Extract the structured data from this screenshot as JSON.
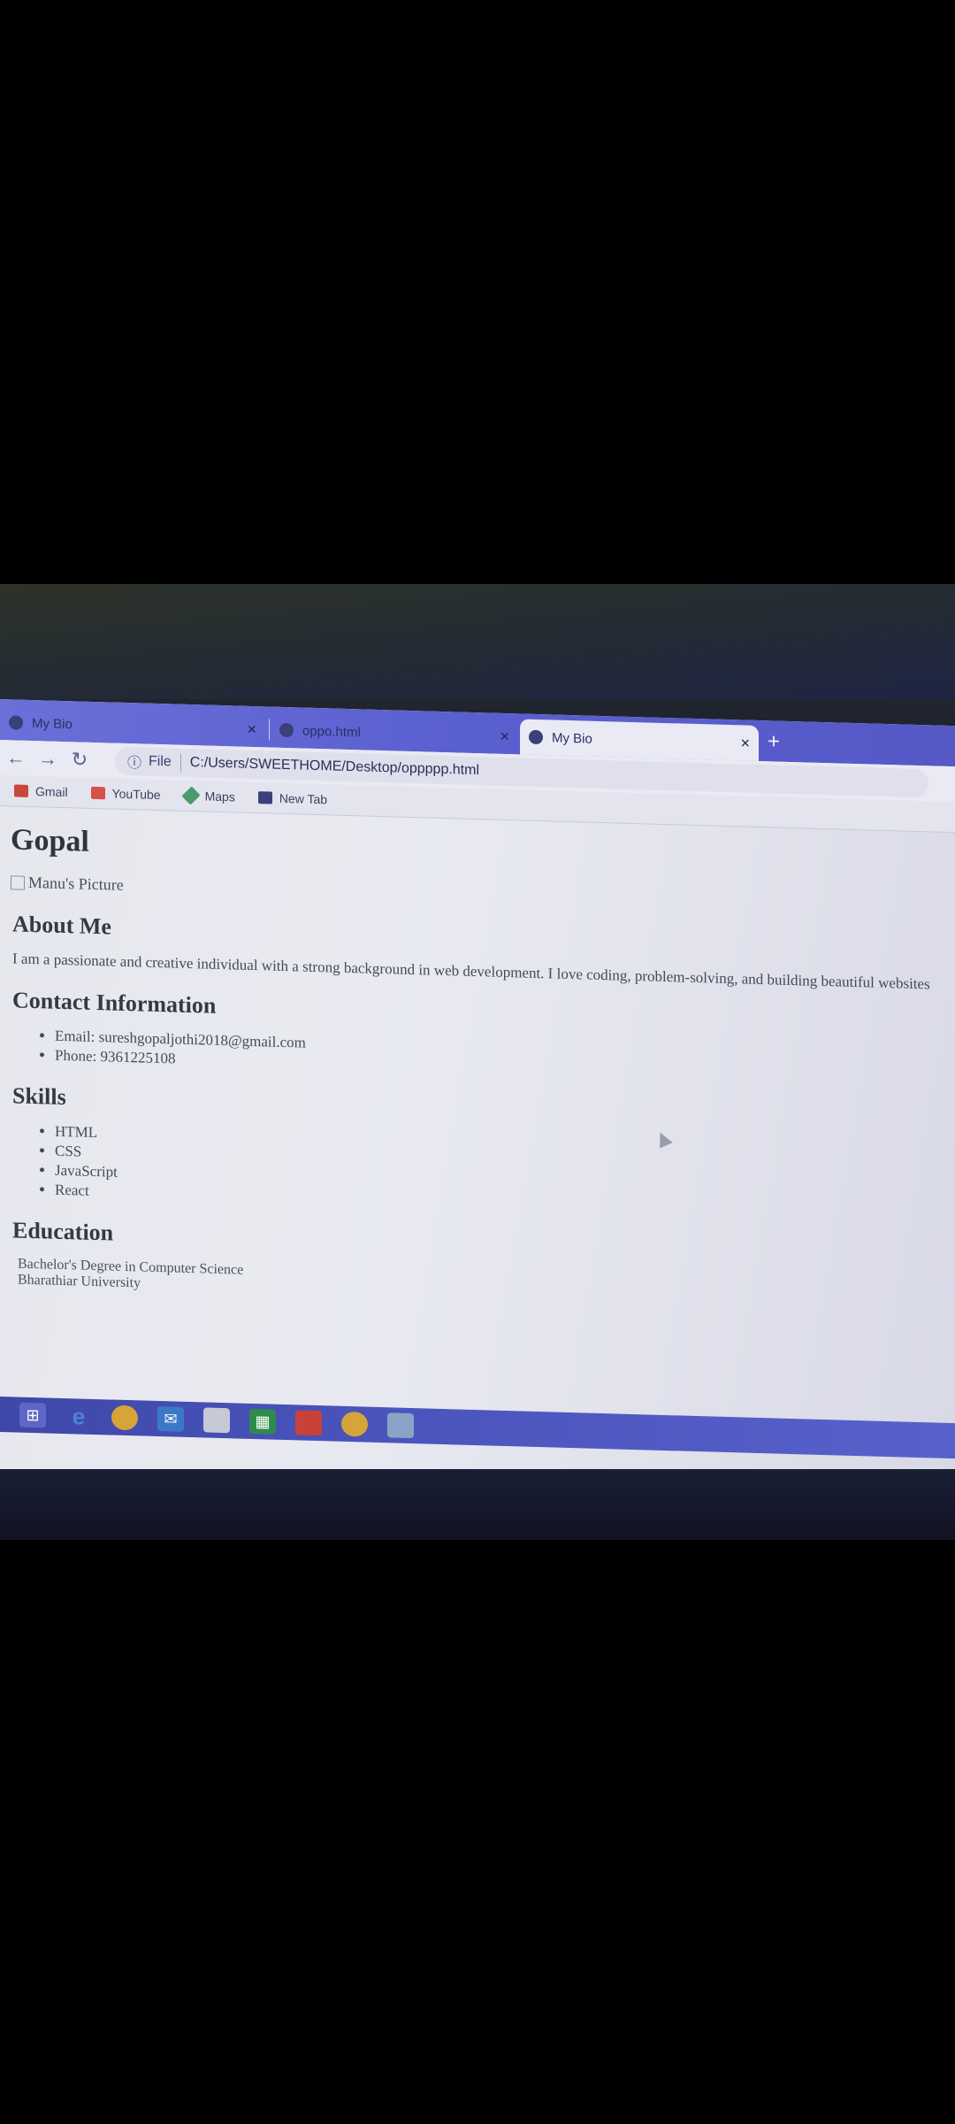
{
  "browser": {
    "tabs": [
      {
        "title": "My Bio"
      },
      {
        "title": "oppo.html"
      },
      {
        "title": "My Bio"
      }
    ],
    "new_tab_glyph": "+",
    "close_glyph": "×",
    "address": {
      "info_glyph": "ⓘ",
      "scheme_label": "File",
      "url": "C:/Users/SWEETHOME/Desktop/oppppp.html"
    },
    "bookmarks": [
      {
        "label": "Gmail",
        "icon": "gmail-icon"
      },
      {
        "label": "YouTube",
        "icon": "youtube-icon"
      },
      {
        "label": "Maps",
        "icon": "maps-icon"
      },
      {
        "label": "New Tab",
        "icon": "globe-icon"
      }
    ]
  },
  "page": {
    "title": "Gopal",
    "image_alt": "Manu's Picture",
    "about_heading": "About Me",
    "about_text": "I am a passionate and creative individual with a strong background in web development. I love coding, problem-solving, and building beautiful websites",
    "contact_heading": "Contact Information",
    "contact": [
      "Email: sureshgopaljothi2018@gmail.com",
      "Phone: 9361225108"
    ],
    "skills_heading": "Skills",
    "skills": [
      "HTML",
      "CSS",
      "JavaScript",
      "React"
    ],
    "education_heading": "Education",
    "education": [
      "Bachelor's Degree in Computer Science",
      "Bharathiar University"
    ]
  },
  "taskbar": {
    "icons": [
      "windows-start-icon",
      "internet-explorer-icon",
      "chrome-icon",
      "mail-icon",
      "file-explorer-icon",
      "calculator-icon",
      "office-icon",
      "chrome-icon",
      "app-icon"
    ]
  }
}
